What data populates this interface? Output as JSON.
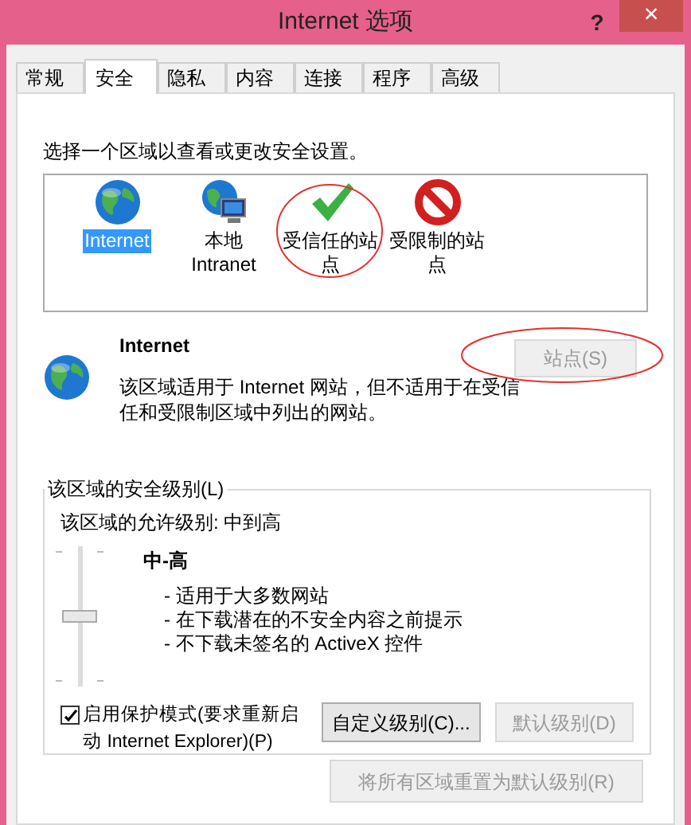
{
  "window": {
    "title": "Internet 选项",
    "help": "?",
    "close": "×"
  },
  "tabs": [
    {
      "label": "常规",
      "selected": false
    },
    {
      "label": "安全",
      "selected": true
    },
    {
      "label": "隐私",
      "selected": false
    },
    {
      "label": "内容",
      "selected": false
    },
    {
      "label": "连接",
      "selected": false
    },
    {
      "label": "程序",
      "selected": false
    },
    {
      "label": "高级",
      "selected": false
    }
  ],
  "zone_prompt": "选择一个区域以查看或更改安全设置。",
  "zones": [
    {
      "kind": "globe",
      "label": "Internet",
      "selected": true,
      "circled": false
    },
    {
      "kind": "intranet",
      "label": "本地 Intranet",
      "selected": false,
      "circled": false
    },
    {
      "kind": "trusted",
      "label": "受信任的站点",
      "selected": false,
      "circled": true
    },
    {
      "kind": "restricted",
      "label": "受限制的站点",
      "selected": false,
      "circled": false
    }
  ],
  "zone_info": {
    "title": "Internet",
    "description": "该区域适用于 Internet 网站，但不适用于在受信任和受限制区域中列出的网站。",
    "sites_button": {
      "label": "站点(S)",
      "disabled": true,
      "circled": true
    }
  },
  "security_level": {
    "legend": "该区域的安全级别(L)",
    "allowed": "该区域的允许级别: 中到高",
    "level": 0.5,
    "level_name": "中-高",
    "bullets": [
      "- 适用于大多数网站",
      "- 在下载潜在的不安全内容之前提示",
      "- 不下载未签名的 ActiveX 控件"
    ],
    "protected_mode": {
      "label": "启用保护模式(要求重新启动 Internet Explorer)(P)",
      "checked": true
    },
    "buttons": [
      {
        "label": "自定义级别(C)...",
        "disabled": false
      },
      {
        "label": "默认级别(D)",
        "disabled": true
      }
    ]
  },
  "reset_button": {
    "label": "将所有区域重置为默认级别(R)",
    "disabled": true
  }
}
